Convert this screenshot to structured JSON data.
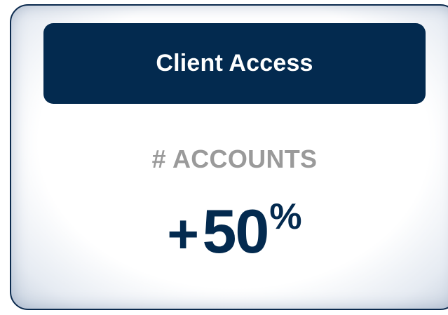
{
  "card": {
    "title": "Client Access",
    "metric_label": "# ACCOUNTS",
    "metric_sign": "+",
    "metric_value": "50",
    "metric_unit": "%",
    "metric_fraction": 0.5
  },
  "colors": {
    "header_bg": "#032a4f",
    "header_text": "#ffffff",
    "label_text": "#9a9a9a",
    "value_text": "#032a4f",
    "card_border": "#0b2a4e"
  }
}
